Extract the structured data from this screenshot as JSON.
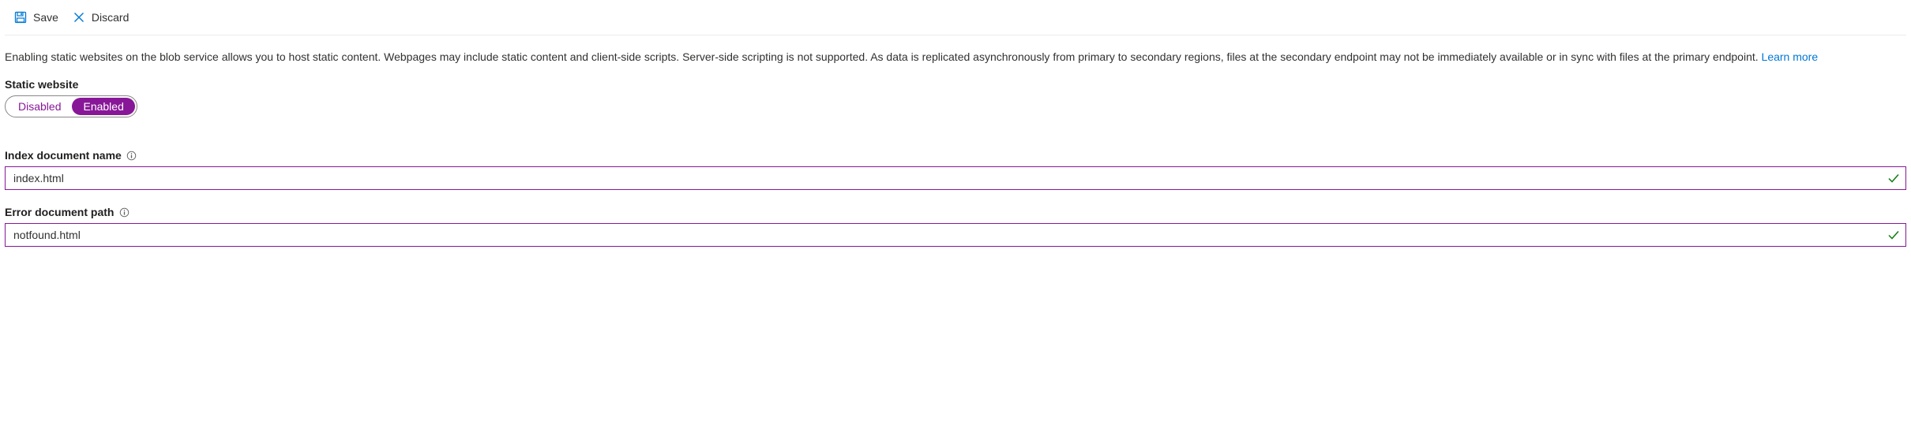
{
  "toolbar": {
    "save_label": "Save",
    "discard_label": "Discard"
  },
  "description": {
    "text": "Enabling static websites on the blob service allows you to host static content. Webpages may include static content and client-side scripts. Server-side scripting is not supported. As data is replicated asynchronously from primary to secondary regions, files at the secondary endpoint may not be immediately available or in sync with files at the primary endpoint. ",
    "learn_more": "Learn more"
  },
  "static_website": {
    "label": "Static website",
    "disabled_label": "Disabled",
    "enabled_label": "Enabled",
    "selected": "Enabled"
  },
  "index_document": {
    "label": "Index document name",
    "value": "index.html"
  },
  "error_document": {
    "label": "Error document path",
    "value": "notfound.html"
  },
  "colors": {
    "accent": "#881798",
    "link": "#0078d4",
    "valid": "#107c10"
  }
}
